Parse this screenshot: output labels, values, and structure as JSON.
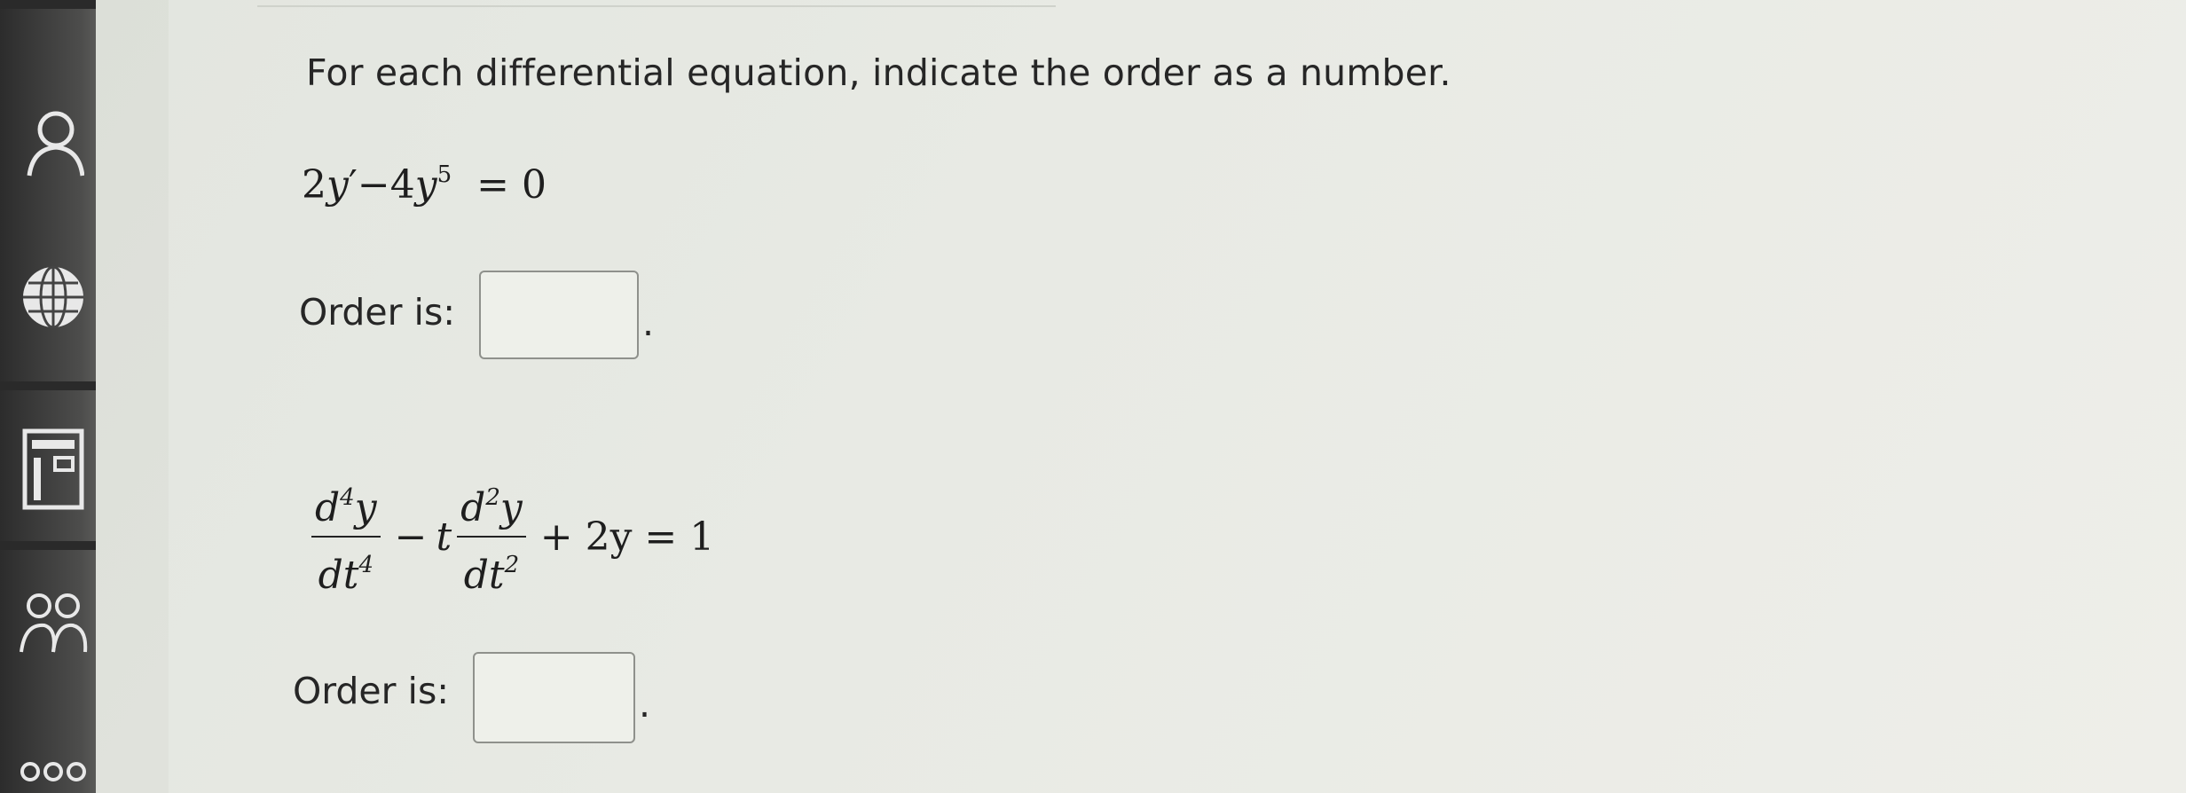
{
  "question": {
    "instruction": "For each differential equation, indicate the order as a number."
  },
  "equation1": {
    "coef1": "2",
    "var1": "y",
    "prime": "′",
    "minus": "−4",
    "var2": "y",
    "exp": "5",
    "rhs": "= 0"
  },
  "equation2": {
    "frac1_num_d": "d",
    "frac1_num_exp": "4",
    "frac1_num_var": "y",
    "frac1_den_dt": "dt",
    "frac1_den_exp": "4",
    "minus": "−",
    "t": "t",
    "frac2_num_d": "d",
    "frac2_num_exp": "2",
    "frac2_num_var": "y",
    "frac2_den_dt": "dt",
    "frac2_den_exp": "2",
    "rest": "+ 2y = 1"
  },
  "answers": [
    {
      "label": "Order is:",
      "value": "",
      "period": "."
    },
    {
      "label": "Order is:",
      "value": "",
      "period": "."
    }
  ],
  "sidebar": {
    "icons": [
      "user-icon",
      "globe-icon",
      "calculator-icon",
      "group-icon",
      "link-icon"
    ]
  }
}
